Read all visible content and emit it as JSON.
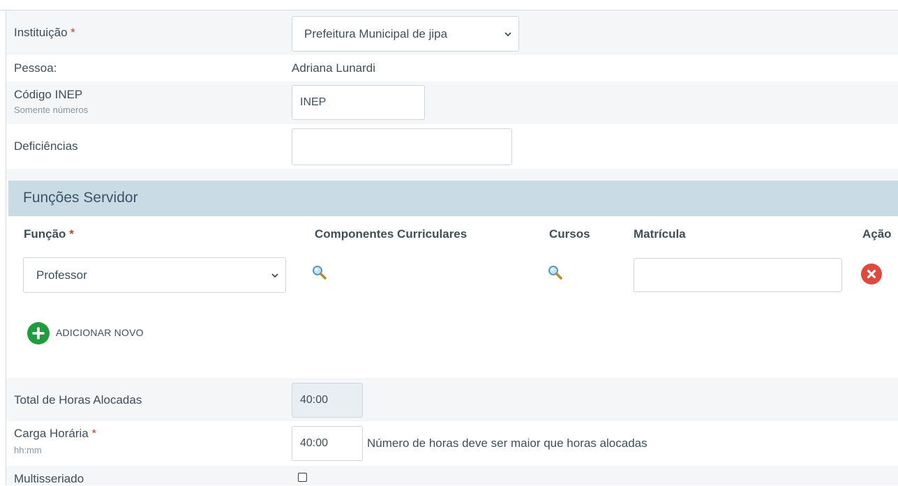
{
  "form": {
    "instituicao": {
      "label": "Instituição",
      "required_mark": "*",
      "selected": "Prefeitura Municipal de jipa"
    },
    "pessoa": {
      "label": "Pessoa:",
      "value": "Adriana Lunardi"
    },
    "codigo_inep": {
      "label": "Código INEP",
      "hint": "Somente números",
      "placeholder": "INEP"
    },
    "deficiencias": {
      "label": "Deficiências",
      "value": ""
    },
    "funcoes_servidor": {
      "title": "Funções Servidor",
      "columns": {
        "funcao": "Função",
        "funcao_required": "*",
        "componentes": "Componentes Curriculares",
        "cursos": "Cursos",
        "matricula": "Matrícula",
        "acao": "Ação"
      },
      "rows": [
        {
          "funcao": "Professor",
          "matricula": ""
        }
      ],
      "add_label": "ADICIONAR NOVO"
    },
    "total_horas": {
      "label": "Total de Horas Alocadas",
      "value": "40:00"
    },
    "carga_horaria": {
      "label": "Carga Horária",
      "required_mark": "*",
      "hint": "hh:mm",
      "value": "40:00",
      "message": "Número de horas deve ser maior que horas alocadas"
    },
    "multisseriado": {
      "label": "Multisseriado",
      "checked": false
    }
  },
  "icons": {
    "chevron": "chevron-down-icon",
    "search": "search-icon",
    "delete": "close-icon",
    "add": "plus-icon"
  },
  "colors": {
    "section_header_bg": "#c9dce5",
    "required": "#b5423a",
    "delete": "#e0493e",
    "add": "#1f9c3d"
  }
}
